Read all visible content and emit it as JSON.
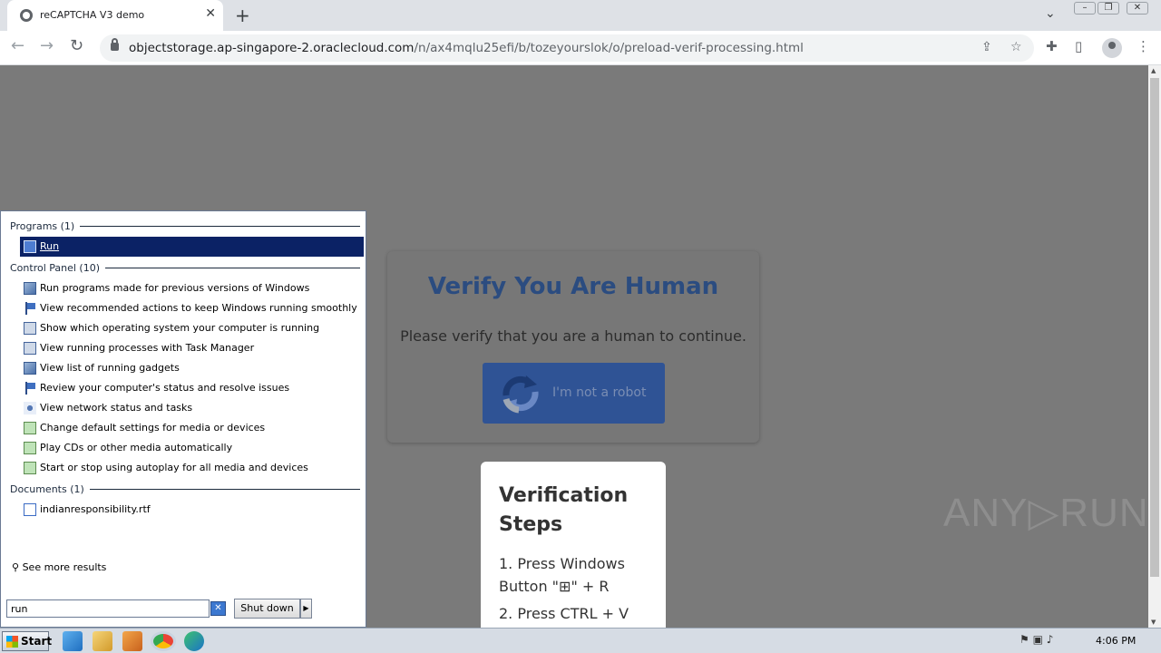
{
  "browser": {
    "tab_title": "reCAPTCHA V3 demo",
    "url_host": "objectstorage.ap-singapore-2.oraclecloud.com",
    "url_path": "/n/ax4mqlu25efi/b/tozeyourslok/o/preload-verif-processing.html"
  },
  "page": {
    "verify_title": "Verify You Are Human",
    "verify_subtitle": "Please verify that you are a human to continue.",
    "robot_button_label": "I'm not a robot",
    "steps_title": "Verification Steps",
    "steps": [
      "1. Press Windows Button \"⊞\" + R",
      "2. Press CTRL + V"
    ],
    "watermark": "ANY▷RUN"
  },
  "start_menu": {
    "groups": {
      "programs": "Programs (1)",
      "control_panel": "Control Panel (10)",
      "documents": "Documents (1)"
    },
    "programs": [
      "Run"
    ],
    "control_panel": [
      "Run programs made for previous versions of Windows",
      "View recommended actions to keep Windows running smoothly",
      "Show which operating system your computer is running",
      "View running processes with Task Manager",
      "View list of running gadgets",
      "Review your computer's status and resolve issues",
      "View network status and tasks",
      "Change default settings for media or devices",
      "Play CDs or other media automatically",
      "Start or stop using autoplay for all media and devices"
    ],
    "documents": [
      "indianresponsibility.rtf"
    ],
    "see_more": "See more results",
    "search_value": "run",
    "shutdown_label": "Shut down"
  },
  "taskbar": {
    "start_label": "Start",
    "clock": "4:06 PM"
  },
  "colors": {
    "overlay": "#7a7a7a",
    "verify_title": "#2b4c80",
    "robot_button": "#2f5395",
    "selection": "#0b2265"
  }
}
